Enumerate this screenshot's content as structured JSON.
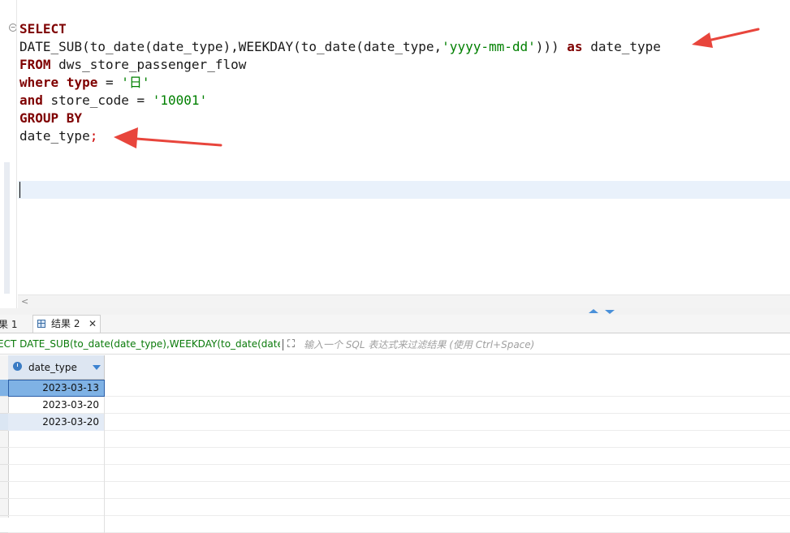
{
  "editor": {
    "code_lines": [
      [
        {
          "t": "SELECT",
          "c": "kw"
        }
      ],
      [
        {
          "t": "DATE_SUB(to_date(date_type),WEEKDAY(to_date(date_type,",
          "c": ""
        },
        {
          "t": "'yyyy-mm-dd'",
          "c": "str"
        },
        {
          "t": "))) ",
          "c": ""
        },
        {
          "t": "as",
          "c": "kw"
        },
        {
          "t": " date_type",
          "c": ""
        }
      ],
      [
        {
          "t": "FROM",
          "c": "kw"
        },
        {
          "t": " dws_store_passenger_flow",
          "c": ""
        }
      ],
      [
        {
          "t": "where",
          "c": "kw"
        },
        {
          "t": " ",
          "c": ""
        },
        {
          "t": "type",
          "c": "kw"
        },
        {
          "t": " = ",
          "c": ""
        },
        {
          "t": "'日'",
          "c": "str"
        }
      ],
      [
        {
          "t": "and",
          "c": "kw"
        },
        {
          "t": " store_code = ",
          "c": ""
        },
        {
          "t": "'10001'",
          "c": "str"
        }
      ],
      [
        {
          "t": "GROUP BY",
          "c": "kw"
        }
      ],
      [
        {
          "t": "date_type",
          "c": ""
        },
        {
          "t": ";",
          "c": "semi"
        }
      ]
    ],
    "fold_icon": "collapse-icon",
    "scroll_left_glyph": "<"
  },
  "tabs": {
    "result1_label": "果 1",
    "result2_label": "结果 2",
    "close_glyph": "✕"
  },
  "query_bar": {
    "query_text": "ECT DATE_SUB(to_date(date_type),WEEKDAY(to_date(date_t",
    "expand_glyph": "⛶",
    "filter_placeholder": "输入一个 SQL 表达式来过滤结果 (使用 Ctrl+Space)"
  },
  "results": {
    "column": "date_type",
    "rows": [
      "2023-03-13",
      "2023-03-20",
      "2023-03-20"
    ]
  },
  "colors": {
    "keyword": "#7f0000",
    "string": "#008000",
    "annotation_arrow": "#e8453c",
    "selected_cell": "#7fb2e5"
  }
}
